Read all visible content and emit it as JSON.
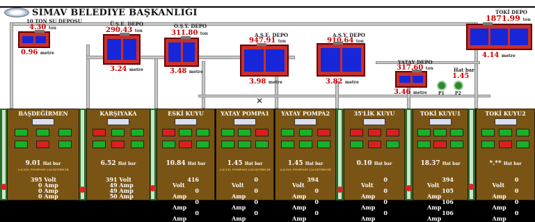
{
  "header": {
    "title": "SİMAV BELEDİYE BAŞKANLIĞI"
  },
  "tanks": [
    {
      "name": "10 TON SU DEPOSU",
      "volume": "4.30",
      "unit": "ton",
      "level": "0.96",
      "level_unit": "metre"
    },
    {
      "name": "Ü.Ş.E. DEPO",
      "volume": "290.43",
      "unit": "ton",
      "level": "3.24",
      "level_unit": "metre"
    },
    {
      "name": "O.Ş.Y. DEPO",
      "volume": "311.80",
      "unit": "ton",
      "level": "3.48",
      "level_unit": "metre"
    },
    {
      "name": "A.Ş.E. DEPO",
      "volume": "947.91",
      "unit": "ton",
      "level": "3.98",
      "level_unit": "metre"
    },
    {
      "name": "A.Ş.Y. DEPO",
      "volume": "910.64",
      "unit": "ton",
      "level": "3.82",
      "level_unit": "metre"
    },
    {
      "name": "YATAY DEPO",
      "volume": "317.60",
      "unit": "ton",
      "level": "3.46",
      "level_unit": "metre"
    },
    {
      "name": "TOKİ DEPO",
      "volume": "1871.99",
      "unit": "ton",
      "level": "4.14",
      "level_unit": "metre"
    }
  ],
  "hat": {
    "label": "Hat bar",
    "value": "1.45"
  },
  "pumps": {
    "p1": "P1",
    "p2": "P2"
  },
  "stations": [
    {
      "name": "BAŞDEĞİRMEN",
      "pressure": "9.01",
      "note": "A.Ş.Y.D. POMPASI ÇALIŞTIRILIR",
      "volt": "395",
      "a1": "0",
      "a2": "0",
      "a3": "0"
    },
    {
      "name": "KARŞIYAKA",
      "pressure": "6.52",
      "note": "",
      "volt": "391",
      "a1": "49",
      "a2": "49",
      "a3": "50"
    },
    {
      "name": "ESKİ KUYU",
      "pressure": "10.84",
      "note": "",
      "volt": "416",
      "a1": "0",
      "a2": "0",
      "a3": "0"
    },
    {
      "name": "YATAY POMPA1",
      "pressure": "1.45",
      "note": "A.Ş.Y.D. POMPASI ÇALIŞTIRILIR",
      "volt": "0",
      "a1": "0",
      "a2": "0",
      "a3": "0"
    },
    {
      "name": "YATAY POMPA2",
      "pressure": "1.45",
      "note": "A.Ş.Y.D. POMPASI ÇALIŞTIRILIR",
      "volt": "394",
      "a1": "0",
      "a2": "0",
      "a3": "0"
    },
    {
      "name": "35'LİK KUYU",
      "pressure": "0.10",
      "note": "",
      "volt": "0",
      "a1": "0",
      "a2": "0",
      "a3": "0"
    },
    {
      "name": "TOKİ KUYU1",
      "pressure": "18.37",
      "note": "",
      "volt": "394",
      "a1": "105",
      "a2": "106",
      "a3": "106"
    },
    {
      "name": "TOKİ KUYU2",
      "pressure": "*.**",
      "note": "",
      "volt": "0",
      "a1": "0",
      "a2": "0",
      "a3": "0"
    }
  ],
  "labels": {
    "hat_bar": "Hat bar",
    "volt": "Volt",
    "amp": "Amp"
  },
  "colors": {
    "tank": "#c8302a",
    "water": "#1626d8",
    "panel": "#7a5414",
    "pole": "#2a6b2a",
    "on": "#18b02a",
    "off": "#d82020"
  }
}
